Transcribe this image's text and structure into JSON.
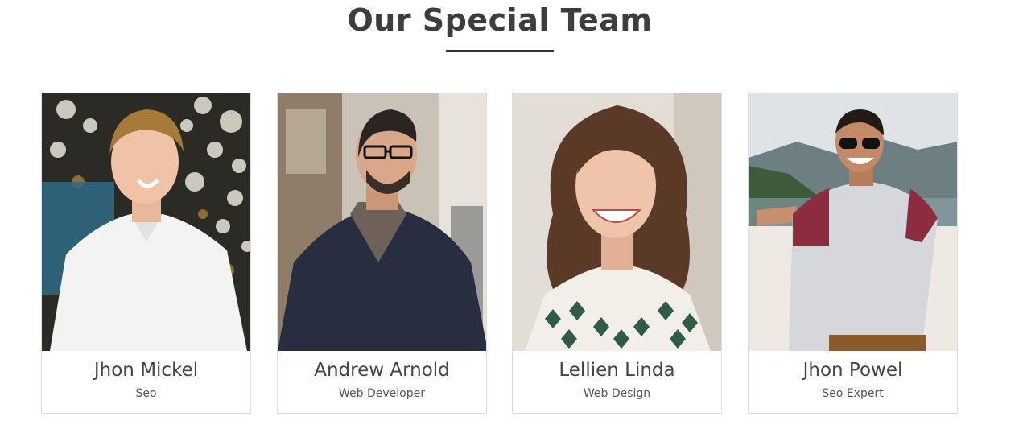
{
  "section": {
    "title": "Our Special Team"
  },
  "team": [
    {
      "name": "Jhon Mickel",
      "role": "Seo",
      "photo": "person-photo-white-shirt"
    },
    {
      "name": "Andrew Arnold",
      "role": "Web Developer",
      "photo": "person-photo-dark-jacket-glasses"
    },
    {
      "name": "Lellien Linda",
      "role": "Web Design",
      "photo": "person-photo-curly-hair-woman"
    },
    {
      "name": "Jhon Powel",
      "role": "Seo Expert",
      "photo": "person-photo-sunglasses-mountains"
    }
  ],
  "colors": {
    "heading": "#3d3d3d",
    "text": "#444444",
    "card_border": "#dddddd"
  }
}
